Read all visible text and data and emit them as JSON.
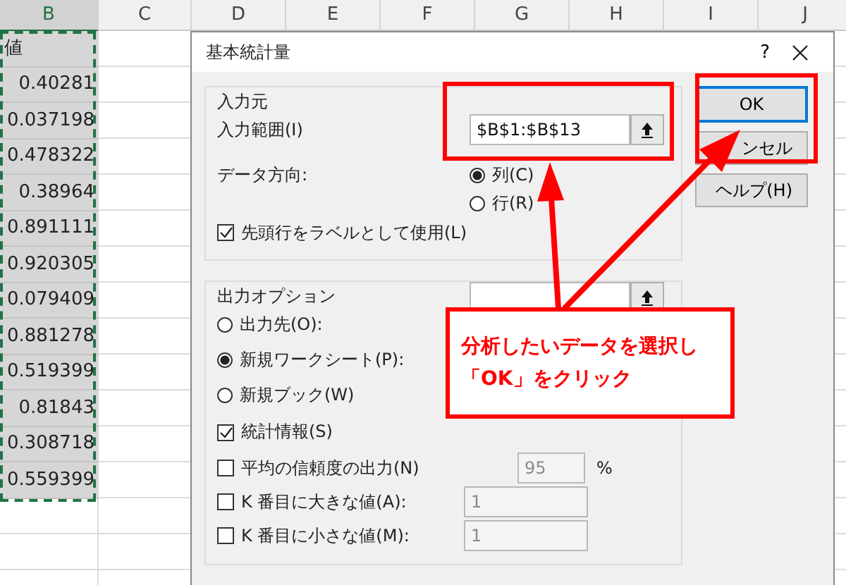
{
  "sheet": {
    "columns": [
      "B",
      "C",
      "D",
      "E",
      "F",
      "G",
      "H",
      "I",
      "J"
    ],
    "cells": [
      "値",
      "0.40281",
      "0.037198",
      "0.478322",
      "0.38964",
      "0.891111",
      "0.920305",
      "0.079409",
      "0.881278",
      "0.519399",
      "0.81843",
      "0.308718",
      "0.559399"
    ]
  },
  "dialog": {
    "title": "基本統計量",
    "help": "?",
    "input_group": {
      "title": "入力元",
      "range_label": "入力範囲(I)",
      "range_value": "$B$1:$B$13",
      "direction_label": "データ方向:",
      "directions": [
        {
          "label": "列(C)",
          "selected": true
        },
        {
          "label": "行(R)",
          "selected": false
        }
      ],
      "labels_checkbox": {
        "label": "先頭行をラベルとして使用(L)",
        "checked": true
      }
    },
    "output_group": {
      "title": "出力オプション",
      "destinations": [
        {
          "label": "出力先(O):",
          "selected": false
        },
        {
          "label": "新規ワークシート(P):",
          "selected": true
        },
        {
          "label": "新規ブック(W)",
          "selected": false
        }
      ],
      "options": [
        {
          "label": "統計情報(S)",
          "checked": true
        },
        {
          "label": "平均の信頼度の出力(N)",
          "checked": false,
          "value": "95",
          "unit": "%"
        },
        {
          "label": "K 番目に大きな値(A):",
          "checked": false,
          "value": "1"
        },
        {
          "label": "K 番目に小さな値(M):",
          "checked": false,
          "value": "1"
        }
      ]
    },
    "buttons": [
      {
        "label": "OK",
        "default": true
      },
      {
        "label": "ンセル",
        "default": false
      },
      {
        "label": "ヘルプ(H)",
        "default": false
      }
    ]
  },
  "callout": {
    "lines": [
      "分析したいデータを選択し",
      "「OK」をクリック"
    ]
  }
}
